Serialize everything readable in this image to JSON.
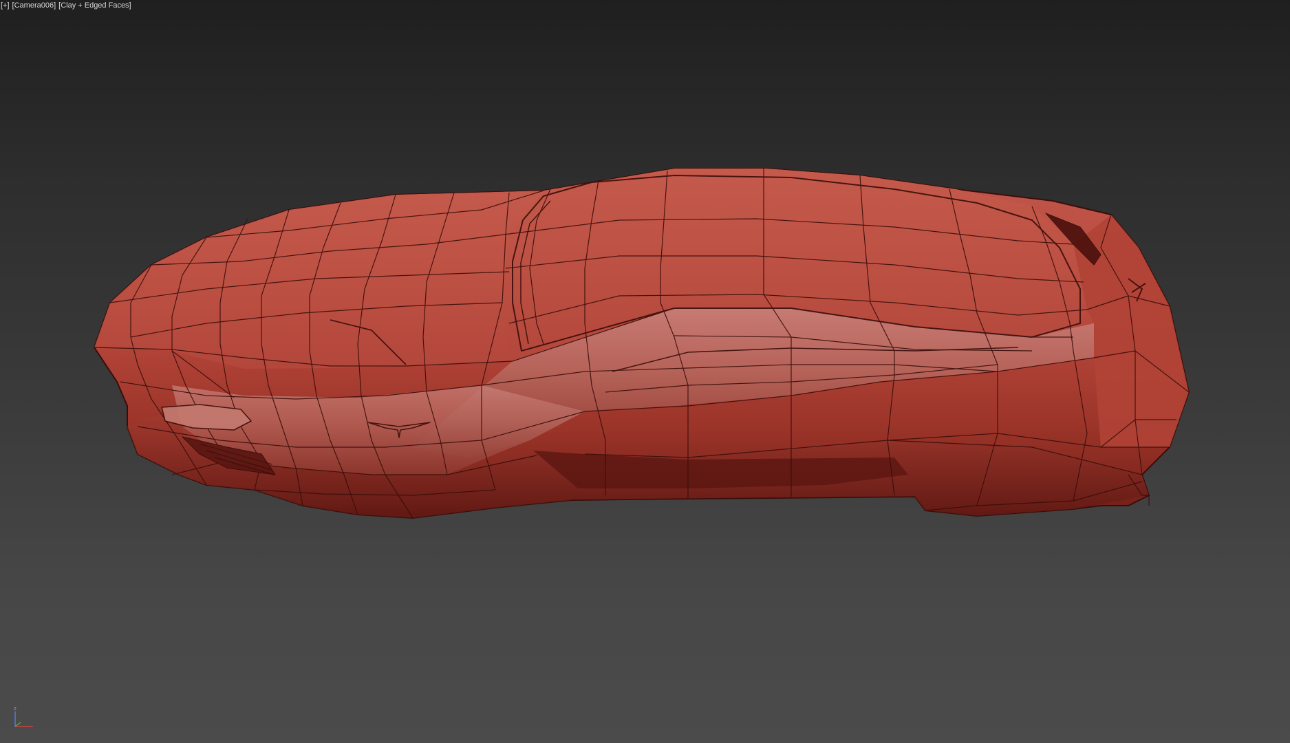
{
  "viewport": {
    "label_plus": "[+]",
    "label_camera": "[Camera006]",
    "label_shading": "[Clay + Edged Faces]",
    "background_top": "#1f1f1f",
    "background_bottom": "#4b4b4b"
  },
  "model": {
    "icon": "car-mesh-icon",
    "clay_color": "#b8483c",
    "clay_highlight": "#d06658",
    "clay_shadow": "#6e1e17",
    "edge_color": "#3a0d0a"
  },
  "axis_gizmo": {
    "icon": "axis-tripod-icon",
    "z_label": "z",
    "x_color": "#e04040",
    "y_color": "#40c040",
    "z_color": "#6080ff"
  }
}
